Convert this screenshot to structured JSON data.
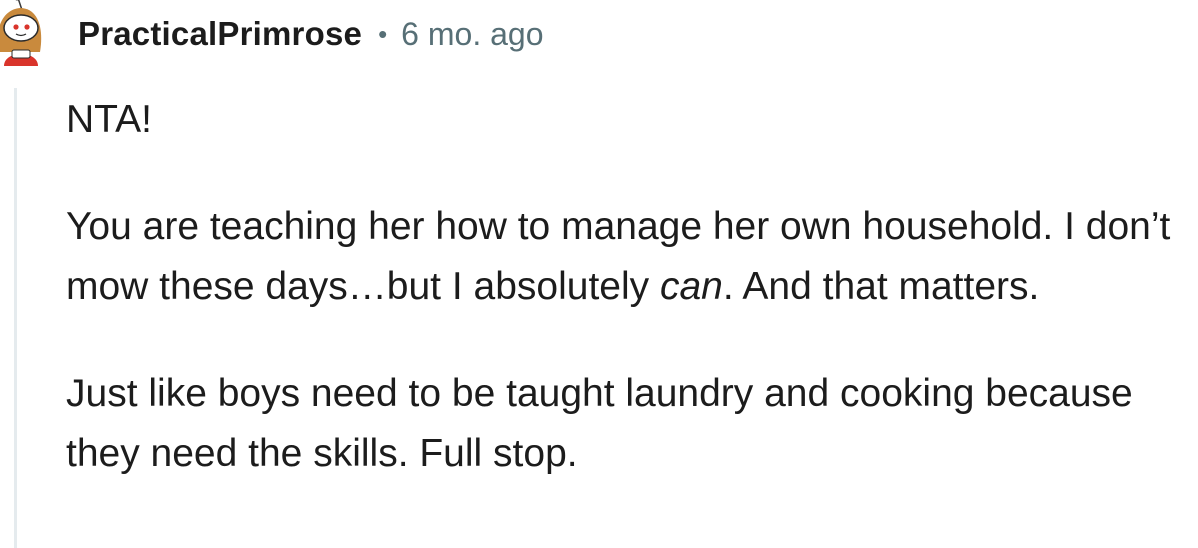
{
  "comment": {
    "author": "PracticalPrimrose",
    "separator": "•",
    "timestamp": "6 mo. ago",
    "avatar_icon": "snoo-avatar-icon",
    "paragraphs": [
      {
        "text": "NTA!"
      },
      {
        "before": "You are teaching her how to manage her own household. I don’t mow these days…but I absolutely ",
        "emphasis": "can",
        "after": ". And that matters."
      },
      {
        "text": "Just like boys need to be taught laundry and cooking because they need the skills. Full stop."
      }
    ]
  },
  "colors": {
    "text": "#1c1c1c",
    "meta": "#576f76",
    "thread_line": "#e5ebee",
    "avatar_hair": "#c98a3d",
    "avatar_shirt": "#d9342b"
  }
}
